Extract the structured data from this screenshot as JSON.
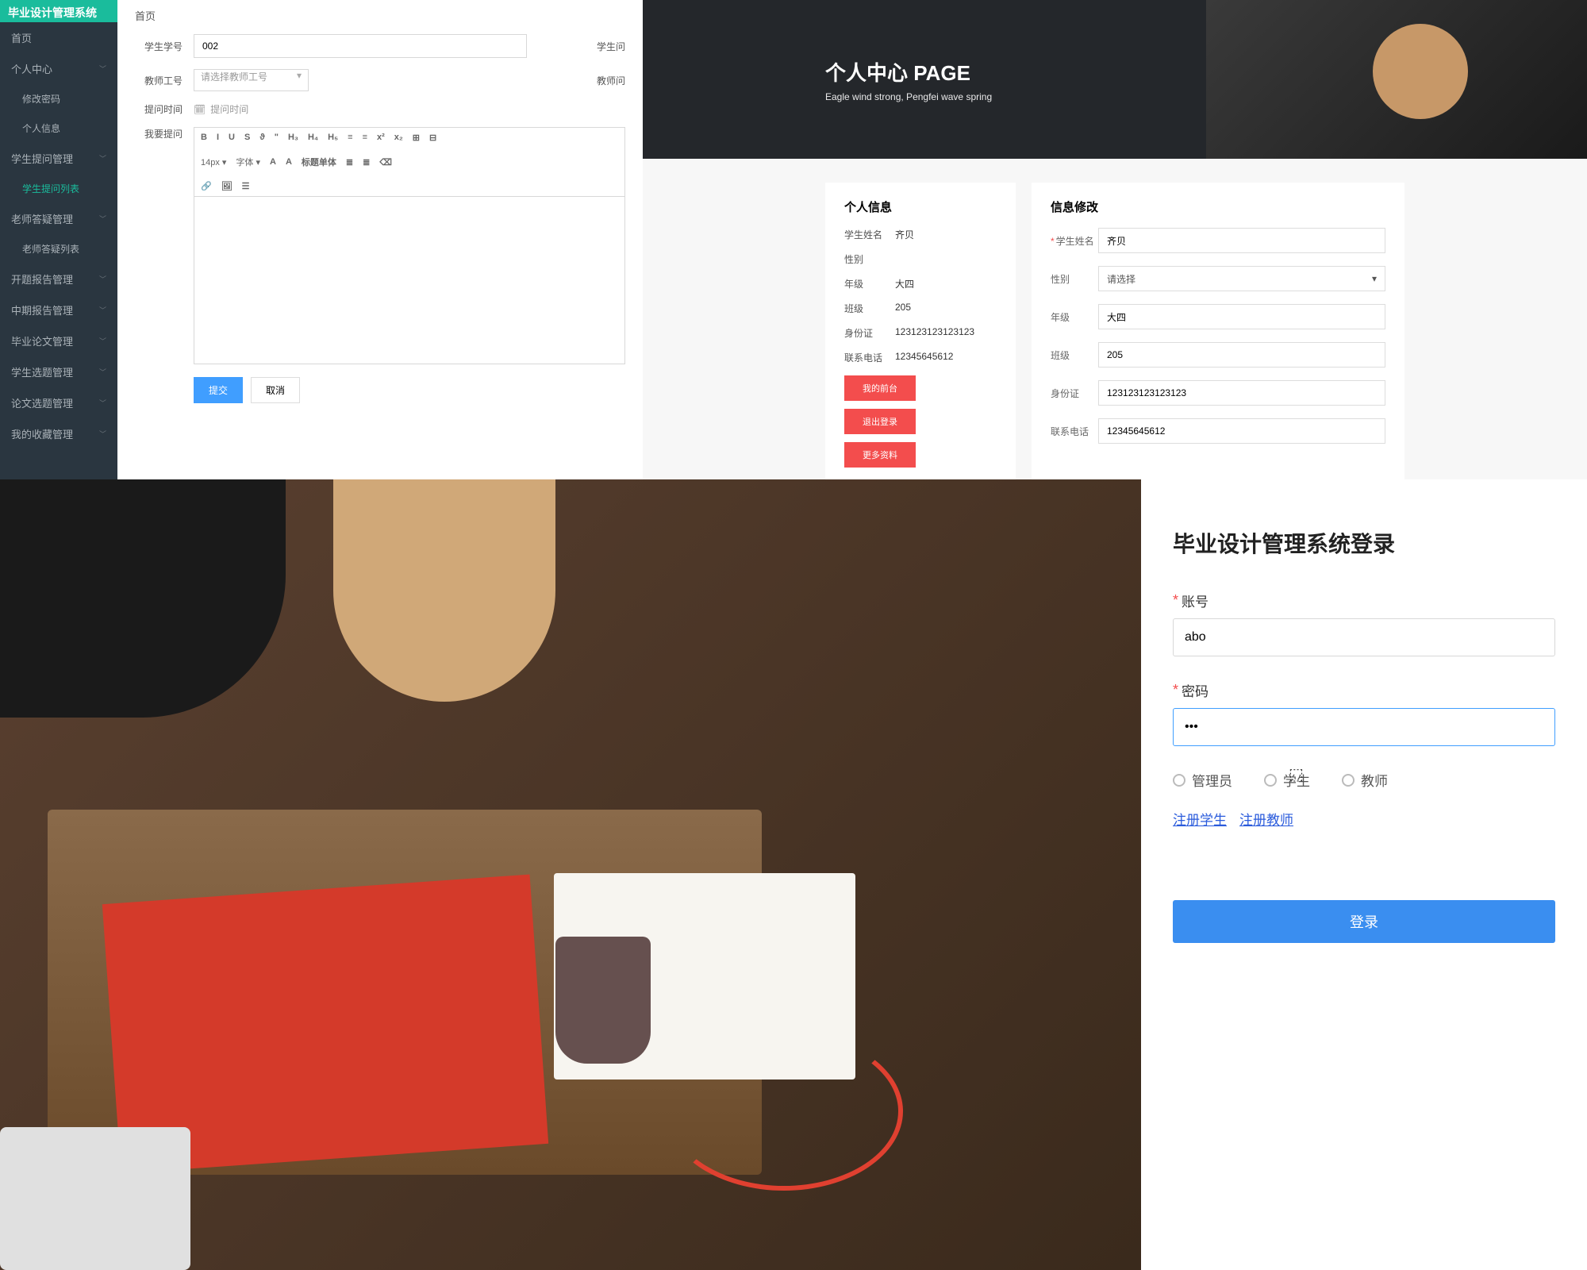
{
  "panel1": {
    "logo": "毕业设计管理系统",
    "breadcrumb": "首页",
    "sidebar": [
      {
        "label": "首页",
        "sub": false,
        "active": false,
        "expandable": false
      },
      {
        "label": "个人中心",
        "sub": false,
        "active": false,
        "expandable": true
      },
      {
        "label": "修改密码",
        "sub": true,
        "active": false,
        "expandable": false
      },
      {
        "label": "个人信息",
        "sub": true,
        "active": false,
        "expandable": false
      },
      {
        "label": "学生提问管理",
        "sub": false,
        "active": false,
        "expandable": true
      },
      {
        "label": "学生提问列表",
        "sub": true,
        "active": true,
        "expandable": false
      },
      {
        "label": "老师答疑管理",
        "sub": false,
        "active": false,
        "expandable": true
      },
      {
        "label": "老师答疑列表",
        "sub": true,
        "active": false,
        "expandable": false
      },
      {
        "label": "开题报告管理",
        "sub": false,
        "active": false,
        "expandable": true
      },
      {
        "label": "中期报告管理",
        "sub": false,
        "active": false,
        "expandable": true
      },
      {
        "label": "毕业论文管理",
        "sub": false,
        "active": false,
        "expandable": true
      },
      {
        "label": "学生选题管理",
        "sub": false,
        "active": false,
        "expandable": true
      },
      {
        "label": "论文选题管理",
        "sub": false,
        "active": false,
        "expandable": true
      },
      {
        "label": "我的收藏管理",
        "sub": false,
        "active": false,
        "expandable": true
      }
    ],
    "form": {
      "student_id_label": "学生学号",
      "student_id_value": "002",
      "teacher_id_label": "教师工号",
      "teacher_id_placeholder": "请选择教师工号",
      "question_time_label": "提问时间",
      "question_time_placeholder": "提问时间",
      "question_content_label": "我要提问",
      "side_label1": "学生问",
      "side_label2": "教师问"
    },
    "editor_toolbar": {
      "row1": [
        "B",
        "I",
        "U",
        "S",
        "ϑ",
        "\"",
        "H₃",
        "H₄",
        "H₅",
        "≡",
        "≡",
        "x²",
        "x₂",
        "⊞",
        "⊟"
      ],
      "row2_font": "14px",
      "row2_fontfam": "字体",
      "row2_items": [
        "A",
        "A",
        "标题单体",
        "≣",
        "≣",
        "⌫"
      ],
      "row3": [
        "🔗",
        "🖼",
        "☰"
      ]
    },
    "buttons": {
      "submit": "提交",
      "cancel": "取消"
    }
  },
  "panel2": {
    "hero_title": "个人中心 PAGE",
    "hero_sub": "Eagle wind strong, Pengfei wave spring",
    "left": {
      "title": "个人信息",
      "rows": [
        {
          "label": "学生姓名",
          "value": "齐贝"
        },
        {
          "label": "性别",
          "value": ""
        },
        {
          "label": "年级",
          "value": "大四"
        },
        {
          "label": "班级",
          "value": "205"
        },
        {
          "label": "身份证",
          "value": "123123123123123"
        },
        {
          "label": "联系电话",
          "value": "12345645612"
        }
      ],
      "btns": [
        "我的前台",
        "退出登录",
        "更多资料"
      ]
    },
    "right": {
      "title": "信息修改",
      "rows": [
        {
          "label": "学生姓名",
          "value": "齐贝",
          "required": true,
          "type": "input"
        },
        {
          "label": "性别",
          "value": "请选择",
          "required": false,
          "type": "select"
        },
        {
          "label": "年级",
          "value": "大四",
          "required": false,
          "type": "input"
        },
        {
          "label": "班级",
          "value": "205",
          "required": false,
          "type": "input"
        },
        {
          "label": "身份证",
          "value": "123123123123123",
          "required": false,
          "type": "input"
        },
        {
          "label": "联系电话",
          "value": "12345645612",
          "required": false,
          "type": "input"
        }
      ]
    }
  },
  "panel3": {
    "title": "毕业设计管理系统登录",
    "account_label": "账号",
    "account_value": "abo",
    "password_label": "密码",
    "password_value": "•••",
    "radios": [
      "管理员",
      "学生",
      "教师"
    ],
    "links": [
      "注册学生",
      "注册教师"
    ],
    "login_btn": "登录"
  }
}
